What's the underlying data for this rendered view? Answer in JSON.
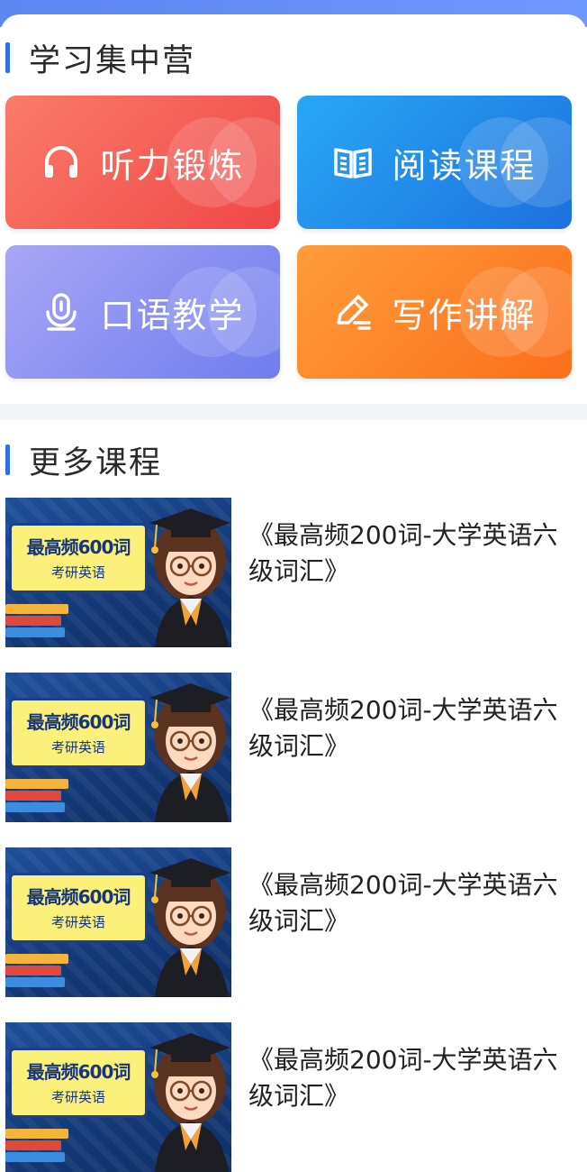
{
  "study_camp": {
    "title": "学习集中营",
    "tiles": [
      {
        "label": "听力锻炼",
        "icon": "headphones-icon",
        "color": "#f2534f"
      },
      {
        "label": "阅读课程",
        "icon": "book-icon",
        "color": "#1f82e6"
      },
      {
        "label": "口语教学",
        "icon": "microphone-icon",
        "color": "#7c85ef"
      },
      {
        "label": "写作讲解",
        "icon": "pencil-icon",
        "color": "#fd7b25"
      }
    ]
  },
  "more_courses": {
    "title": "更多课程",
    "items": [
      {
        "title": "《最高频200词-大学英语六级词汇》",
        "thumb_heading": "最高频600词",
        "thumb_subtitle": "考研英语"
      },
      {
        "title": "《最高频200词-大学英语六级词汇》",
        "thumb_heading": "最高频600词",
        "thumb_subtitle": "考研英语"
      },
      {
        "title": "《最高频200词-大学英语六级词汇》",
        "thumb_heading": "最高频600词",
        "thumb_subtitle": "考研英语"
      },
      {
        "title": "《最高频200词-大学英语六级词汇》",
        "thumb_heading": "最高频600词",
        "thumb_subtitle": "考研英语"
      }
    ]
  },
  "colors": {
    "accent": "#2f6fe6",
    "header_blue": "#6790f6"
  }
}
